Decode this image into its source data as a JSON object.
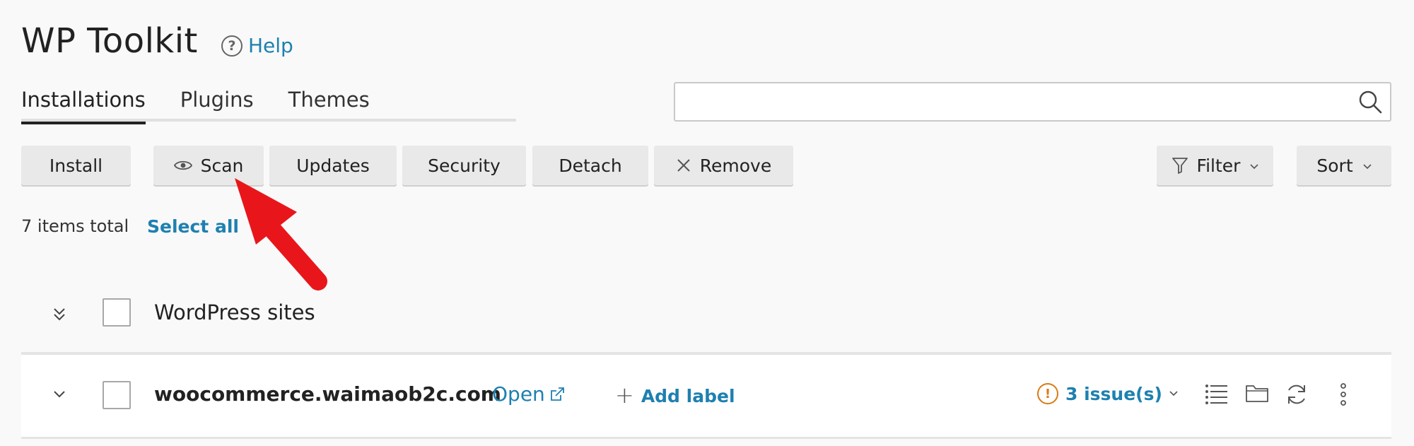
{
  "header": {
    "title": "WP Toolkit",
    "help_label": "Help"
  },
  "tabs": [
    {
      "label": "Installations",
      "active": true
    },
    {
      "label": "Plugins",
      "active": false
    },
    {
      "label": "Themes",
      "active": false
    }
  ],
  "search": {
    "value": "",
    "placeholder": ""
  },
  "toolbar": {
    "install_label": "Install",
    "scan_label": "Scan",
    "updates_label": "Updates",
    "security_label": "Security",
    "detach_label": "Detach",
    "remove_label": "Remove",
    "filter_label": "Filter",
    "sort_label": "Sort"
  },
  "summary": {
    "items_total": "7 items total",
    "select_all": "Select all"
  },
  "group": {
    "label": "WordPress sites"
  },
  "sites": [
    {
      "domain": "woocommerce.waimaob2c.com",
      "open_label": "Open",
      "add_label": "Add label",
      "issues_label": "3 issue(s)"
    }
  ],
  "colors": {
    "link": "#1e80b0",
    "warning": "#d97b14",
    "annotation_arrow": "#e8161b"
  },
  "icons": {
    "help": "question-circle-icon",
    "search": "magnifier-icon",
    "scan": "eye-icon",
    "remove": "x-icon",
    "filter": "funnel-icon",
    "group_toggle": "double-chevron-down-icon",
    "row_toggle": "chevron-down-icon",
    "open_external": "external-link-icon",
    "warning": "exclamation-circle-icon",
    "list_view": "list-icon",
    "file_manager": "folder-icon",
    "refresh": "refresh-icon",
    "more": "kebab-icon"
  }
}
